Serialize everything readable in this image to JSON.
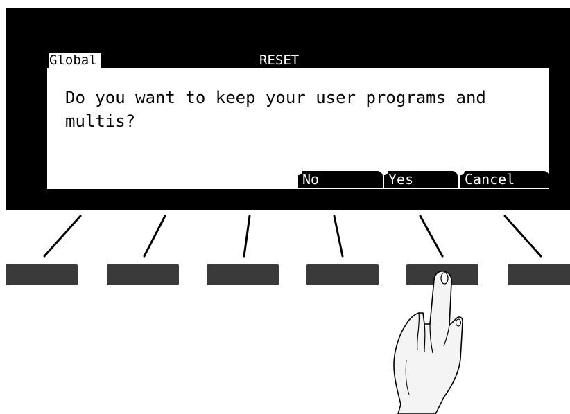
{
  "display": {
    "mode": "Global",
    "title": "RESET",
    "message": "Do you want to keep your user programs and multis?",
    "softkeys": [
      {
        "label": "No"
      },
      {
        "label": "Yes"
      },
      {
        "label": "Cancel"
      }
    ]
  },
  "hardware": {
    "button_count": 6,
    "pressed_button_index": 4,
    "button_color": "#3a3a3a"
  },
  "icons": {
    "pointer": "pointing-hand-icon"
  }
}
